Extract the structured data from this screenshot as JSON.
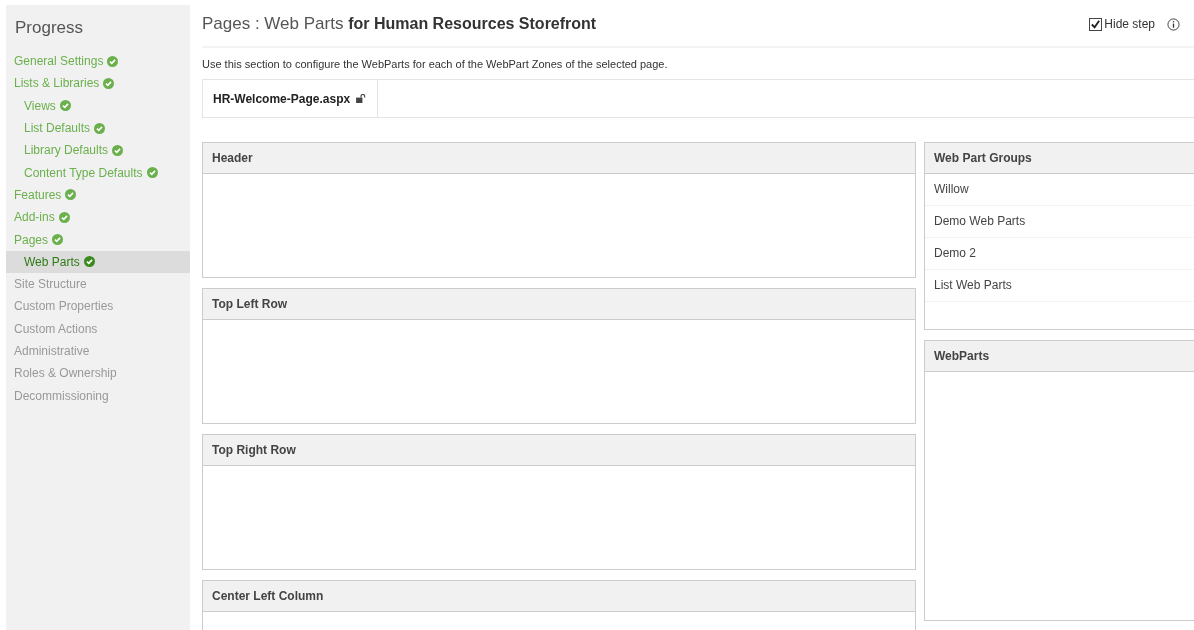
{
  "sidebar": {
    "title": "Progress",
    "items": [
      {
        "label": "General Settings",
        "completed": true,
        "selected": false
      },
      {
        "label": "Lists & Libraries",
        "completed": true,
        "selected": false,
        "children": [
          {
            "label": "Views",
            "completed": true,
            "selected": false
          },
          {
            "label": "List Defaults",
            "completed": true,
            "selected": false
          },
          {
            "label": "Library Defaults",
            "completed": true,
            "selected": false
          },
          {
            "label": "Content Type Defaults",
            "completed": true,
            "selected": false
          }
        ]
      },
      {
        "label": "Features",
        "completed": true,
        "selected": false
      },
      {
        "label": "Add-ins",
        "completed": true,
        "selected": false
      },
      {
        "label": "Pages",
        "completed": true,
        "selected": false,
        "children": [
          {
            "label": "Web Parts",
            "completed": true,
            "selected": true
          }
        ]
      },
      {
        "label": "Site Structure",
        "completed": false,
        "selected": false
      },
      {
        "label": "Custom Properties",
        "completed": false,
        "selected": false
      },
      {
        "label": "Custom Actions",
        "completed": false,
        "selected": false
      },
      {
        "label": "Administrative",
        "completed": false,
        "selected": false
      },
      {
        "label": "Roles & Ownership",
        "completed": false,
        "selected": false
      },
      {
        "label": "Decommissioning",
        "completed": false,
        "selected": false
      }
    ]
  },
  "header": {
    "title": "Pages : Web Parts",
    "subtitle": "for Human Resources Storefront",
    "hide_step": {
      "label": "Hide step",
      "checked": true
    }
  },
  "description": "Use this section to configure the WebParts for each of the WebPart Zones of the selected page.",
  "page_file": {
    "name": "HR-Welcome-Page.aspx",
    "locked": false
  },
  "zones": [
    {
      "title": "Header"
    },
    {
      "title": "Top Left Row"
    },
    {
      "title": "Top Right Row"
    },
    {
      "title": "Center Left Column"
    }
  ],
  "web_part_groups": {
    "title": "Web Part Groups",
    "items": [
      "Willow",
      "Demo Web Parts",
      "Demo 2",
      "List Web Parts"
    ]
  },
  "web_parts": {
    "title": "WebParts"
  }
}
